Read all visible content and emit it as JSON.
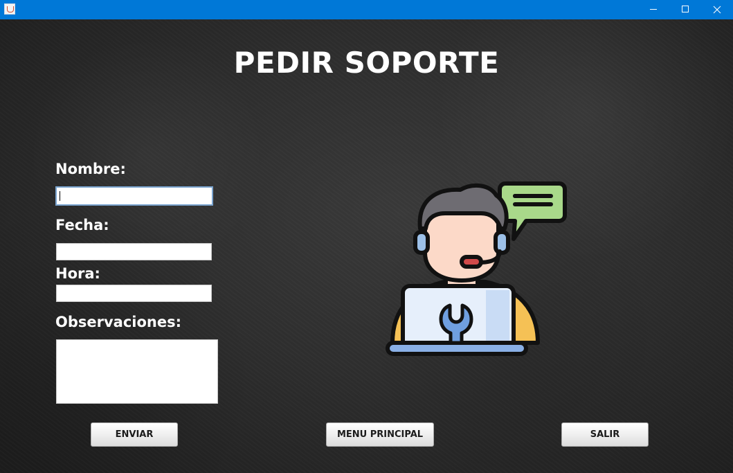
{
  "window": {
    "title": "",
    "titlebar_color": "#0078d7",
    "icons": {
      "app": "java-app-icon",
      "minimize": "minimize-icon",
      "maximize": "maximize-icon",
      "close": "close-icon"
    }
  },
  "page": {
    "title": "PEDIR SOPORTE"
  },
  "form": {
    "nombre": {
      "label": "Nombre:",
      "value": ""
    },
    "fecha": {
      "label": "Fecha:",
      "value": ""
    },
    "hora": {
      "label": "Hora:",
      "value": ""
    },
    "observaciones": {
      "label": "Observaciones:",
      "value": ""
    }
  },
  "buttons": {
    "enviar": "ENVIAR",
    "menu_principal": "MENU PRINCIPAL",
    "salir": "SALIR"
  },
  "illustration": {
    "icon": "support-technician-icon",
    "colors": {
      "hair": "#6e6c72",
      "skin": "#fcd9c8",
      "outline": "#111111",
      "headset": "#9cc0e8",
      "laptop": "#e6effb",
      "laptop_base": "#8ab0e6",
      "wrench": "#6f9fe0",
      "bubble": "#a9d98a",
      "shirt": "#f5c155"
    }
  }
}
